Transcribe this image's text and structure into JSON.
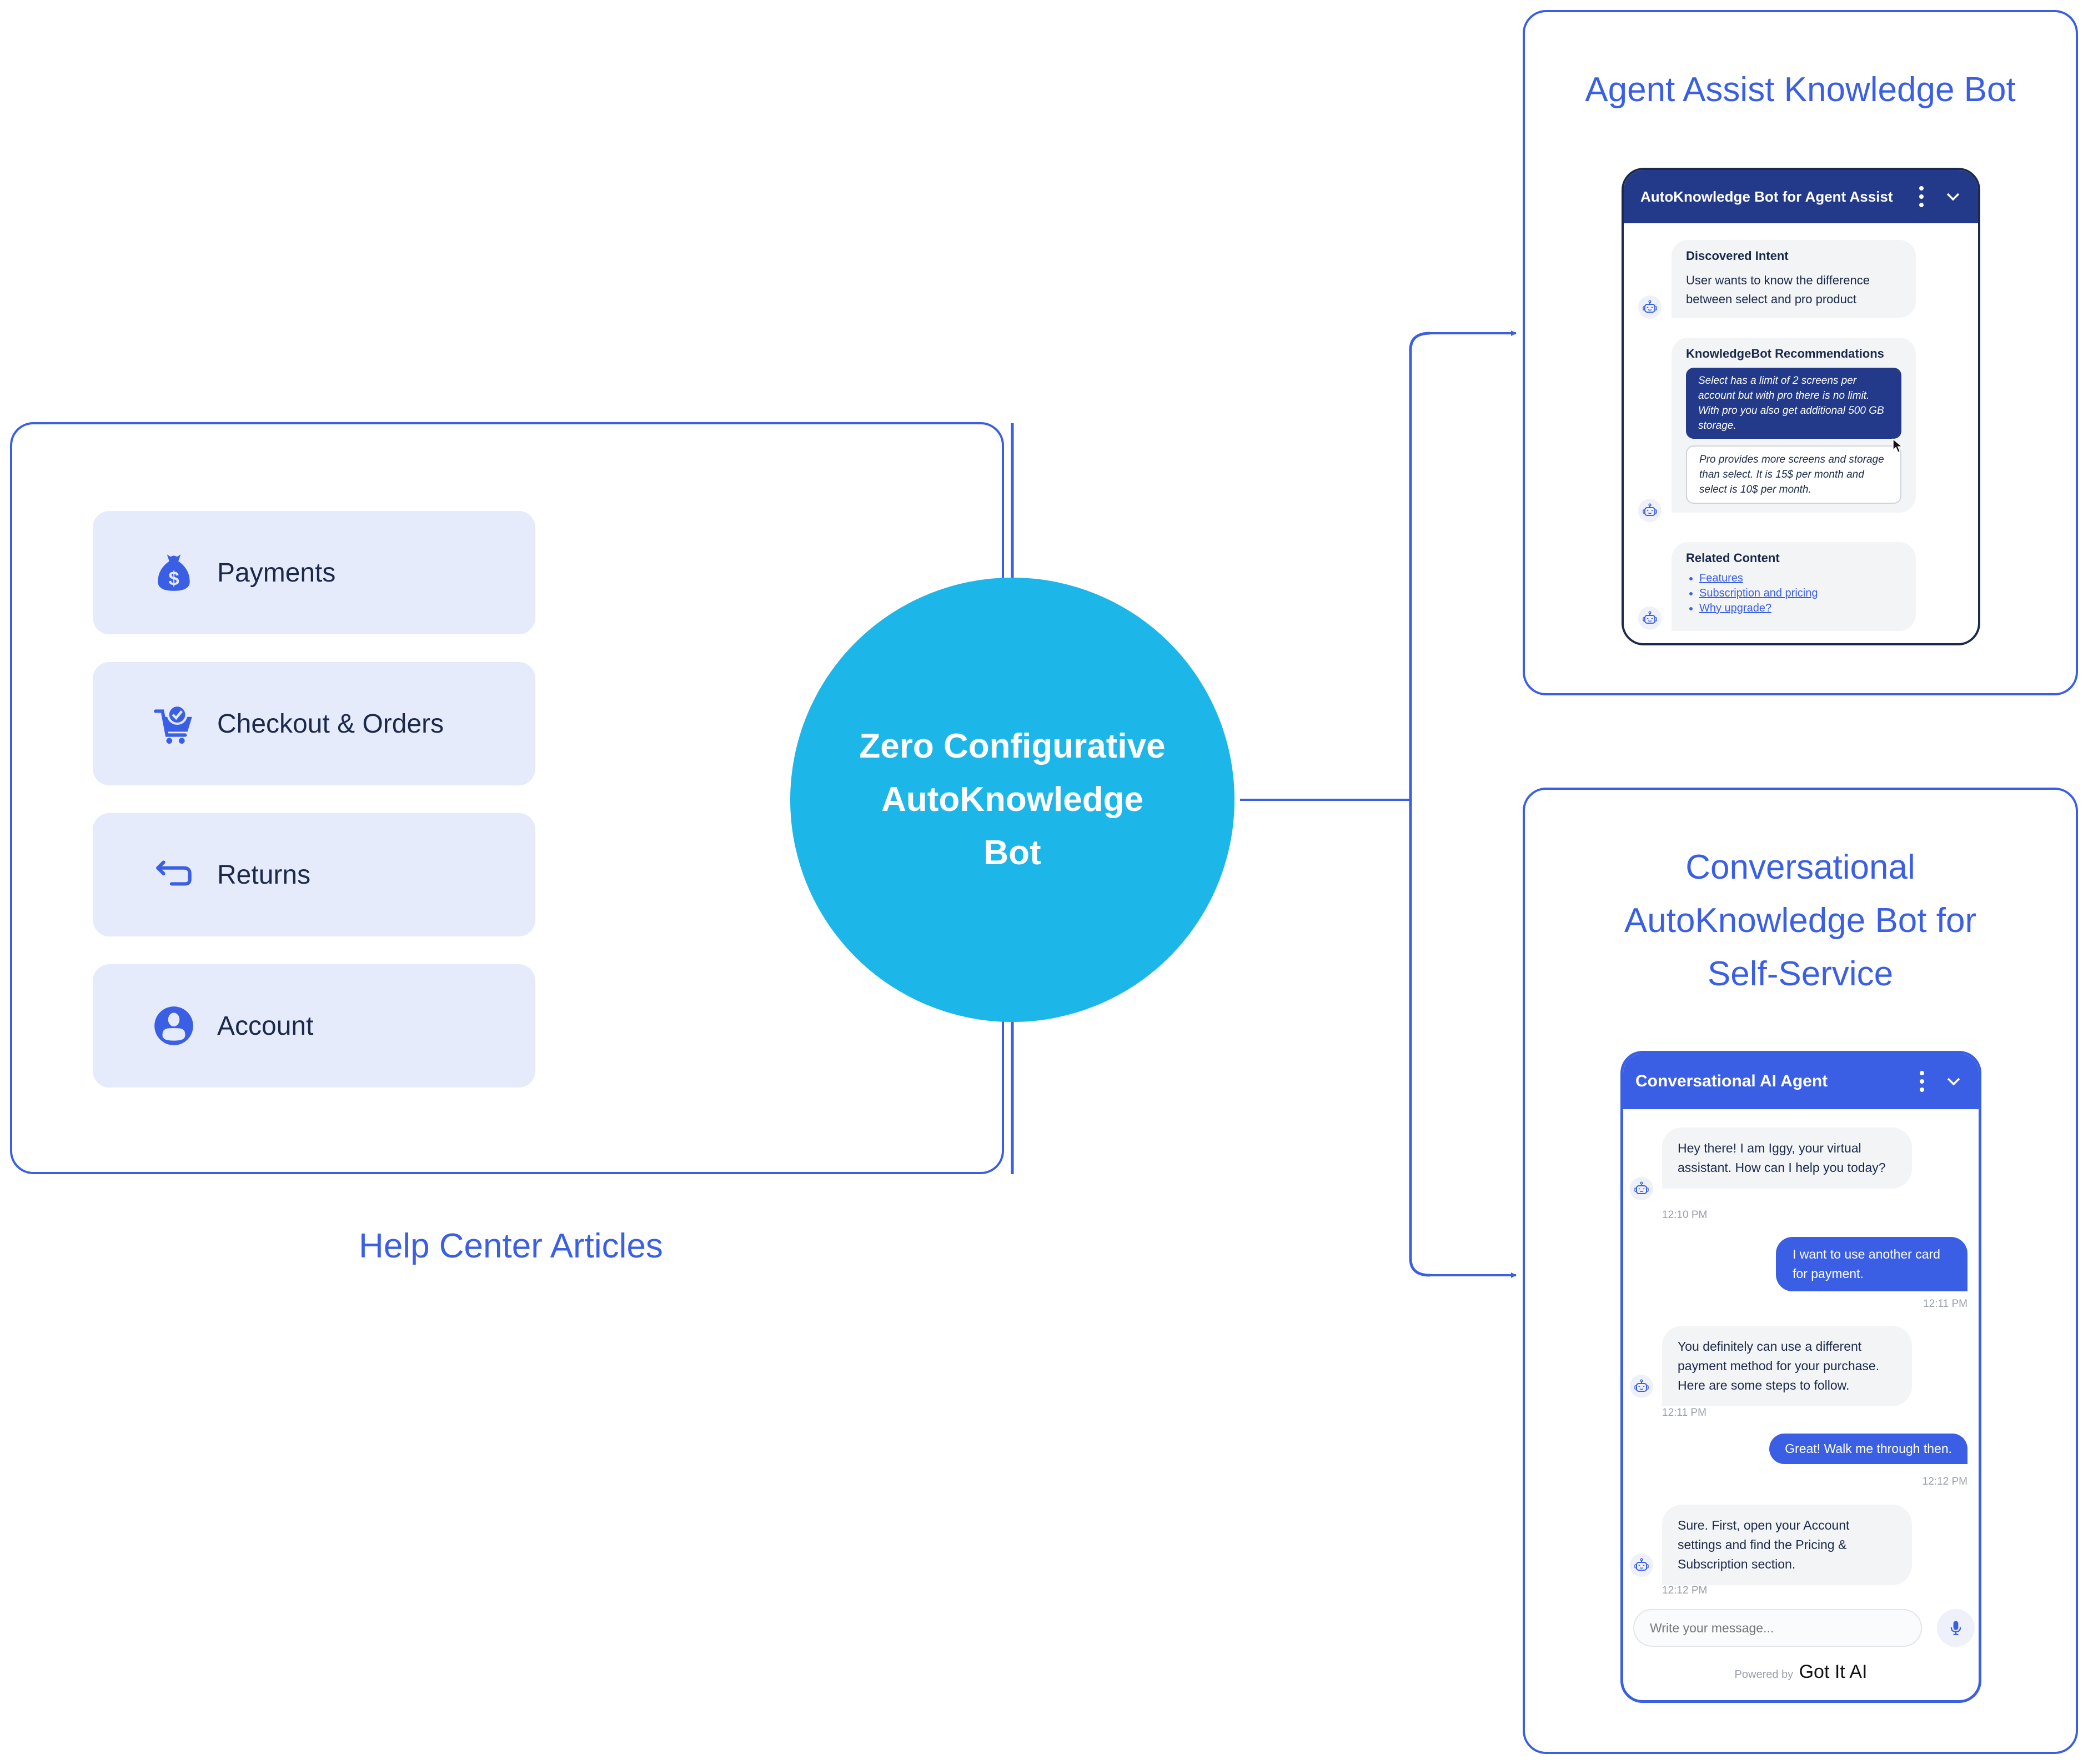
{
  "colors": {
    "accent": "#3a5fe5",
    "hub": "#1db6e8",
    "topic_bg": "#e5ebfa",
    "agent_assist_header": "#233a8b",
    "text_dark": "#1b2a4a"
  },
  "help_center": {
    "caption": "Help Center Articles",
    "topics": [
      {
        "label": "Payments",
        "icon": "money-bag-icon"
      },
      {
        "label": "Checkout & Orders",
        "icon": "cart-check-icon"
      },
      {
        "label": "Returns",
        "icon": "return-arrow-icon"
      },
      {
        "label": "Account",
        "icon": "user-circle-icon"
      }
    ]
  },
  "hub": {
    "lines": [
      "Zero Configurative",
      "AutoKnowledge",
      "Bot"
    ]
  },
  "agent_assist_panel": {
    "title": "Agent Assist Knowledge Bot",
    "widget": {
      "title": "AutoKnowledge Bot for Agent Assist",
      "discovered_intent": {
        "heading": "Discovered Intent",
        "text": "User wants to know the difference between select and pro product"
      },
      "recommendations": {
        "heading": "KnowledgeBot Recommendations",
        "items": [
          {
            "text": "Select has a limit of 2 screens per account but with pro there is no limit. With pro you also get additional 500 GB storage.",
            "selected": true
          },
          {
            "text": "Pro provides more screens and storage than select. It is 15$ per month and select is 10$ per month.",
            "selected": false
          }
        ]
      },
      "related_content": {
        "heading": "Related Content",
        "links": [
          "Features",
          "Subscription and pricing",
          "Why upgrade?"
        ]
      }
    }
  },
  "self_service_panel": {
    "title_lines": [
      "Conversational",
      "AutoKnowledge Bot for",
      "Self-Service"
    ],
    "widget": {
      "title": "Conversational AI Agent",
      "messages": [
        {
          "from": "bot",
          "text": "Hey there! I am Iggy, your virtual assistant. How can I help you today?",
          "time": "12:10 PM"
        },
        {
          "from": "user",
          "text": "I want to use another card for payment.",
          "time": "12:11 PM"
        },
        {
          "from": "bot",
          "text": "You definitely can use a different payment method for your purchase. Here are some steps to follow.",
          "time": "12:11 PM"
        },
        {
          "from": "user",
          "text": "Great! Walk me through then.",
          "time": "12:12 PM"
        },
        {
          "from": "bot",
          "text": "Sure. First, open your Account settings and find the Pricing & Subscription section.",
          "time": "12:12 PM"
        }
      ],
      "input_placeholder": "Write your message...",
      "powered_by": "Powered by",
      "brand": "Got It AI"
    }
  }
}
